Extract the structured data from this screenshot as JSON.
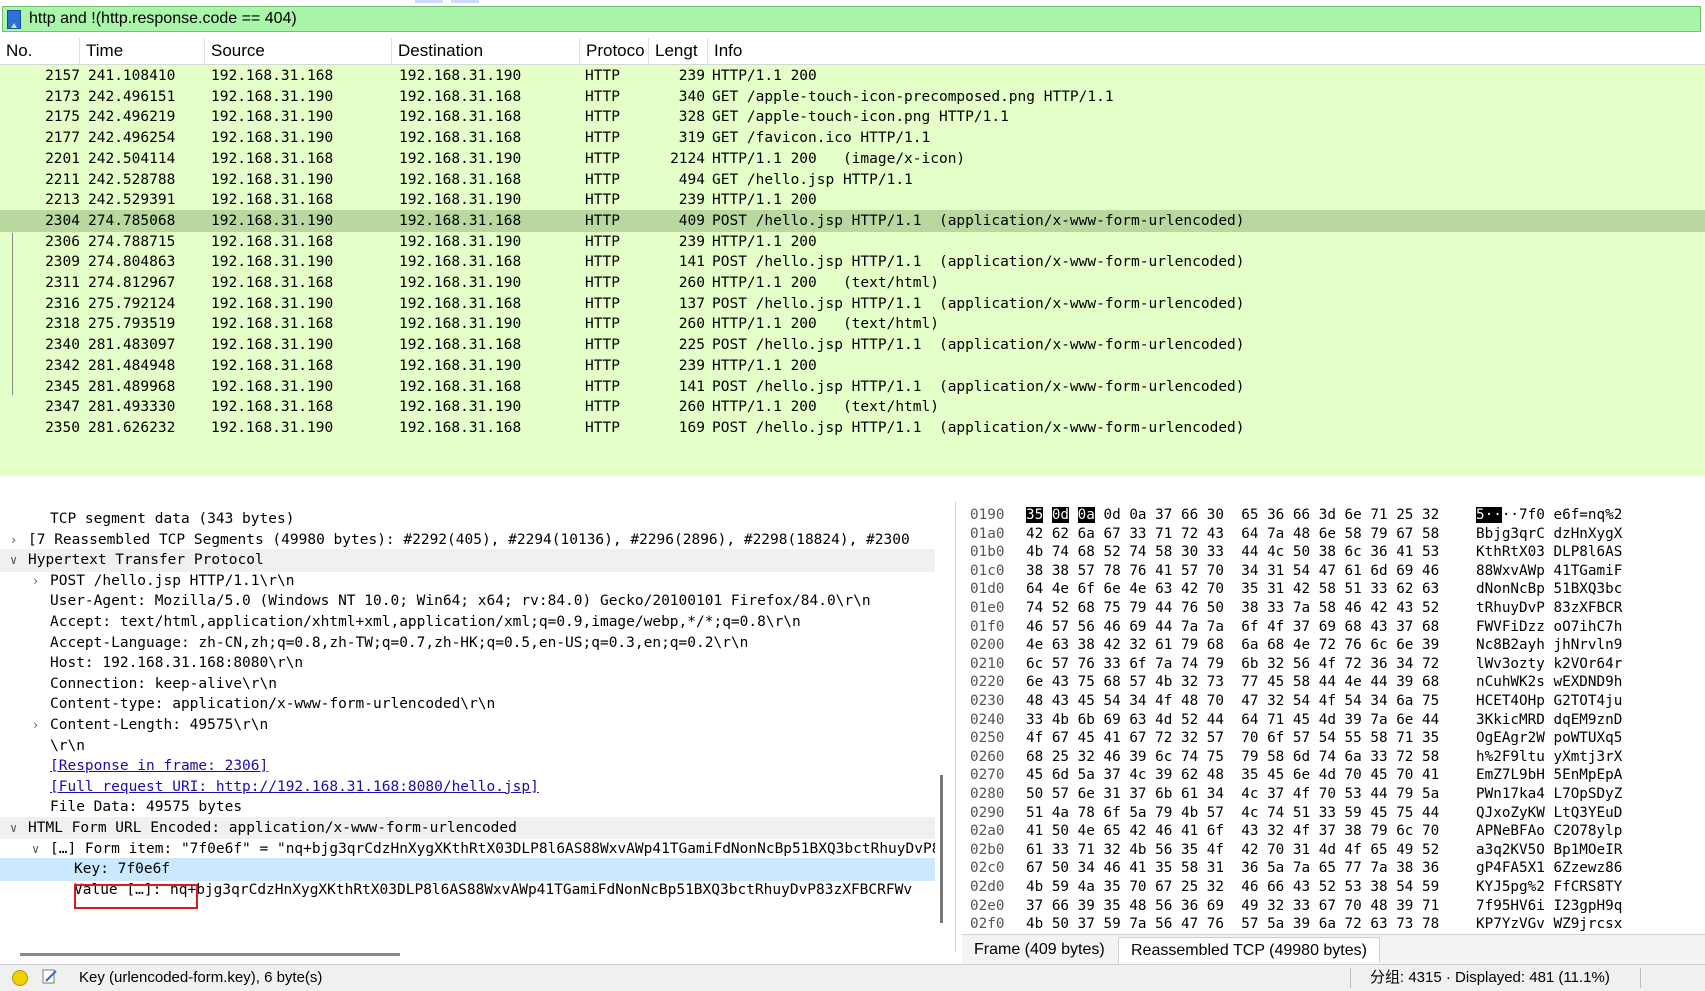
{
  "filter": {
    "value": "http and !(http.response.code == 404)",
    "icon": "bookmark-icon",
    "color": "#a9f5a9"
  },
  "packet_list": {
    "columns": [
      "No.",
      "Time",
      "Source",
      "Destination",
      "Protoco",
      "Lengt",
      "Info"
    ],
    "rows": [
      {
        "no": "2157",
        "time": "241.108410",
        "src": "192.168.31.168",
        "dst": "192.168.31.190",
        "proto": "HTTP",
        "len": "239",
        "info": "HTTP/1.1 200"
      },
      {
        "no": "2173",
        "time": "242.496151",
        "src": "192.168.31.190",
        "dst": "192.168.31.168",
        "proto": "HTTP",
        "len": "340",
        "info": "GET /apple-touch-icon-precomposed.png HTTP/1.1"
      },
      {
        "no": "2175",
        "time": "242.496219",
        "src": "192.168.31.190",
        "dst": "192.168.31.168",
        "proto": "HTTP",
        "len": "328",
        "info": "GET /apple-touch-icon.png HTTP/1.1"
      },
      {
        "no": "2177",
        "time": "242.496254",
        "src": "192.168.31.190",
        "dst": "192.168.31.168",
        "proto": "HTTP",
        "len": "319",
        "info": "GET /favicon.ico HTTP/1.1"
      },
      {
        "no": "2201",
        "time": "242.504114",
        "src": "192.168.31.168",
        "dst": "192.168.31.190",
        "proto": "HTTP",
        "len": "2124",
        "info": "HTTP/1.1 200   (image/x-icon)"
      },
      {
        "no": "2211",
        "time": "242.528788",
        "src": "192.168.31.190",
        "dst": "192.168.31.168",
        "proto": "HTTP",
        "len": "494",
        "info": "GET /hello.jsp HTTP/1.1"
      },
      {
        "no": "2213",
        "time": "242.529391",
        "src": "192.168.31.168",
        "dst": "192.168.31.190",
        "proto": "HTTP",
        "len": "239",
        "info": "HTTP/1.1 200"
      },
      {
        "no": "2304",
        "time": "274.785068",
        "src": "192.168.31.190",
        "dst": "192.168.31.168",
        "proto": "HTTP",
        "len": "409",
        "info": "POST /hello.jsp HTTP/1.1  (application/x-www-form-urlencoded)"
      },
      {
        "no": "2306",
        "time": "274.788715",
        "src": "192.168.31.168",
        "dst": "192.168.31.190",
        "proto": "HTTP",
        "len": "239",
        "info": "HTTP/1.1 200"
      },
      {
        "no": "2309",
        "time": "274.804863",
        "src": "192.168.31.190",
        "dst": "192.168.31.168",
        "proto": "HTTP",
        "len": "141",
        "info": "POST /hello.jsp HTTP/1.1  (application/x-www-form-urlencoded)"
      },
      {
        "no": "2311",
        "time": "274.812967",
        "src": "192.168.31.168",
        "dst": "192.168.31.190",
        "proto": "HTTP",
        "len": "260",
        "info": "HTTP/1.1 200   (text/html)"
      },
      {
        "no": "2316",
        "time": "275.792124",
        "src": "192.168.31.190",
        "dst": "192.168.31.168",
        "proto": "HTTP",
        "len": "137",
        "info": "POST /hello.jsp HTTP/1.1  (application/x-www-form-urlencoded)"
      },
      {
        "no": "2318",
        "time": "275.793519",
        "src": "192.168.31.168",
        "dst": "192.168.31.190",
        "proto": "HTTP",
        "len": "260",
        "info": "HTTP/1.1 200   (text/html)"
      },
      {
        "no": "2340",
        "time": "281.483097",
        "src": "192.168.31.190",
        "dst": "192.168.31.168",
        "proto": "HTTP",
        "len": "225",
        "info": "POST /hello.jsp HTTP/1.1  (application/x-www-form-urlencoded)"
      },
      {
        "no": "2342",
        "time": "281.484948",
        "src": "192.168.31.168",
        "dst": "192.168.31.190",
        "proto": "HTTP",
        "len": "239",
        "info": "HTTP/1.1 200"
      },
      {
        "no": "2345",
        "time": "281.489968",
        "src": "192.168.31.190",
        "dst": "192.168.31.168",
        "proto": "HTTP",
        "len": "141",
        "info": "POST /hello.jsp HTTP/1.1  (application/x-www-form-urlencoded)"
      },
      {
        "no": "2347",
        "time": "281.493330",
        "src": "192.168.31.168",
        "dst": "192.168.31.190",
        "proto": "HTTP",
        "len": "260",
        "info": "HTTP/1.1 200   (text/html)"
      },
      {
        "no": "2350",
        "time": "281.626232",
        "src": "192.168.31.190",
        "dst": "192.168.31.168",
        "proto": "HTTP",
        "len": "169",
        "info": "POST /hello.jsp HTTP/1.1  (application/x-www-form-urlencoded)"
      }
    ],
    "selected_no": "2304",
    "row_color": "#e4ffc7",
    "selected_color": "#b8d8a0"
  },
  "details": {
    "lines": [
      {
        "text": "TCP segment data (343 bytes)",
        "indent": 2,
        "arrow": ""
      },
      {
        "text": "[7 Reassembled TCP Segments (49980 bytes): #2292(405), #2294(10136), #2296(2896), #2298(18824), #2300",
        "indent": 1,
        "arrow": "right"
      },
      {
        "text": "Hypertext Transfer Protocol",
        "indent": 1,
        "arrow": "down",
        "hl": true
      },
      {
        "text": "POST /hello.jsp HTTP/1.1\\r\\n",
        "indent": 2,
        "arrow": "right"
      },
      {
        "text": "User-Agent: Mozilla/5.0 (Windows NT 10.0; Win64; x64; rv:84.0) Gecko/20100101 Firefox/84.0\\r\\n",
        "indent": 2,
        "arrow": ""
      },
      {
        "text": "Accept: text/html,application/xhtml+xml,application/xml;q=0.9,image/webp,*/*;q=0.8\\r\\n",
        "indent": 2,
        "arrow": ""
      },
      {
        "text": "Accept-Language: zh-CN,zh;q=0.8,zh-TW;q=0.7,zh-HK;q=0.5,en-US;q=0.3,en;q=0.2\\r\\n",
        "indent": 2,
        "arrow": ""
      },
      {
        "text": "Host: 192.168.31.168:8080\\r\\n",
        "indent": 2,
        "arrow": ""
      },
      {
        "text": "Connection: keep-alive\\r\\n",
        "indent": 2,
        "arrow": ""
      },
      {
        "text": "Content-type: application/x-www-form-urlencoded\\r\\n",
        "indent": 2,
        "arrow": ""
      },
      {
        "text": "Content-Length: 49575\\r\\n",
        "indent": 2,
        "arrow": "right"
      },
      {
        "text": "\\r\\n",
        "indent": 2,
        "arrow": ""
      },
      {
        "text": "[Response in frame: 2306]",
        "indent": 2,
        "arrow": "",
        "link": true
      },
      {
        "text": "[Full request URI: http://192.168.31.168:8080/hello.jsp]",
        "indent": 2,
        "arrow": "",
        "link": true
      },
      {
        "text": "File Data: 49575 bytes",
        "indent": 2,
        "arrow": ""
      },
      {
        "text": "HTML Form URL Encoded: application/x-www-form-urlencoded",
        "indent": 1,
        "arrow": "down",
        "hl": true
      },
      {
        "text": "[…] Form item: \"7f0e6f\" = \"nq+bjg3qrCdzHnXygXKthRtX03DLP8l6AS88WxvAWp41TGamiFdNonNcBp51BXQ3bctRhuyDvP83zXFBCRFWv",
        "indent": 2,
        "arrow": "down"
      },
      {
        "text": "Key: 7f0e6f",
        "indent": 3,
        "arrow": "",
        "sel": true
      },
      {
        "text": "Value […]: nq+bjg3qrCdzHnXygXKthRtX03DLP8l6AS88WxvAWp41TGamiFdNonNcBp51BXQ3bctRhuyDvP83zXFBCRFWv",
        "indent": 3,
        "arrow": ""
      }
    ]
  },
  "bytes": {
    "rows": [
      {
        "off": "0190",
        "hex1": [
          "35",
          "0d",
          "0a",
          "0d",
          "0a",
          "37",
          "66",
          "30"
        ],
        "hex2": [
          "65",
          "36",
          "66",
          "3d",
          "6e",
          "71",
          "25",
          "32"
        ],
        "asc1": "5····7f0",
        "asc2": "e6f=nq%2"
      },
      {
        "off": "01a0",
        "hex1": [
          "42",
          "62",
          "6a",
          "67",
          "33",
          "71",
          "72",
          "43"
        ],
        "hex2": [
          "64",
          "7a",
          "48",
          "6e",
          "58",
          "79",
          "67",
          "58"
        ],
        "asc1": "Bbjg3qrC",
        "asc2": "dzHnXygX"
      },
      {
        "off": "01b0",
        "hex1": [
          "4b",
          "74",
          "68",
          "52",
          "74",
          "58",
          "30",
          "33"
        ],
        "hex2": [
          "44",
          "4c",
          "50",
          "38",
          "6c",
          "36",
          "41",
          "53"
        ],
        "asc1": "KthRtX03",
        "asc2": "DLP8l6AS"
      },
      {
        "off": "01c0",
        "hex1": [
          "38",
          "38",
          "57",
          "78",
          "76",
          "41",
          "57",
          "70"
        ],
        "hex2": [
          "34",
          "31",
          "54",
          "47",
          "61",
          "6d",
          "69",
          "46"
        ],
        "asc1": "88WxvAWp",
        "asc2": "41TGamiF"
      },
      {
        "off": "01d0",
        "hex1": [
          "64",
          "4e",
          "6f",
          "6e",
          "4e",
          "63",
          "42",
          "70"
        ],
        "hex2": [
          "35",
          "31",
          "42",
          "58",
          "51",
          "33",
          "62",
          "63"
        ],
        "asc1": "dNonNcBp",
        "asc2": "51BXQ3bc"
      },
      {
        "off": "01e0",
        "hex1": [
          "74",
          "52",
          "68",
          "75",
          "79",
          "44",
          "76",
          "50"
        ],
        "hex2": [
          "38",
          "33",
          "7a",
          "58",
          "46",
          "42",
          "43",
          "52"
        ],
        "asc1": "tRhuyDvP",
        "asc2": "83zXFBCR"
      },
      {
        "off": "01f0",
        "hex1": [
          "46",
          "57",
          "56",
          "46",
          "69",
          "44",
          "7a",
          "7a"
        ],
        "hex2": [
          "6f",
          "4f",
          "37",
          "69",
          "68",
          "43",
          "37",
          "68"
        ],
        "asc1": "FWVFiDzz",
        "asc2": "oO7ihC7h"
      },
      {
        "off": "0200",
        "hex1": [
          "4e",
          "63",
          "38",
          "42",
          "32",
          "61",
          "79",
          "68"
        ],
        "hex2": [
          "6a",
          "68",
          "4e",
          "72",
          "76",
          "6c",
          "6e",
          "39"
        ],
        "asc1": "Nc8B2ayh",
        "asc2": "jhNrvln9"
      },
      {
        "off": "0210",
        "hex1": [
          "6c",
          "57",
          "76",
          "33",
          "6f",
          "7a",
          "74",
          "79"
        ],
        "hex2": [
          "6b",
          "32",
          "56",
          "4f",
          "72",
          "36",
          "34",
          "72"
        ],
        "asc1": "lWv3ozty",
        "asc2": "k2VOr64r"
      },
      {
        "off": "0220",
        "hex1": [
          "6e",
          "43",
          "75",
          "68",
          "57",
          "4b",
          "32",
          "73"
        ],
        "hex2": [
          "77",
          "45",
          "58",
          "44",
          "4e",
          "44",
          "39",
          "68"
        ],
        "asc1": "nCuhWK2s",
        "asc2": "wEXDND9h"
      },
      {
        "off": "0230",
        "hex1": [
          "48",
          "43",
          "45",
          "54",
          "34",
          "4f",
          "48",
          "70"
        ],
        "hex2": [
          "47",
          "32",
          "54",
          "4f",
          "54",
          "34",
          "6a",
          "75"
        ],
        "asc1": "HCET4OHp",
        "asc2": "G2TOT4ju"
      },
      {
        "off": "0240",
        "hex1": [
          "33",
          "4b",
          "6b",
          "69",
          "63",
          "4d",
          "52",
          "44"
        ],
        "hex2": [
          "64",
          "71",
          "45",
          "4d",
          "39",
          "7a",
          "6e",
          "44"
        ],
        "asc1": "3KkicMRD",
        "asc2": "dqEM9znD"
      },
      {
        "off": "0250",
        "hex1": [
          "4f",
          "67",
          "45",
          "41",
          "67",
          "72",
          "32",
          "57"
        ],
        "hex2": [
          "70",
          "6f",
          "57",
          "54",
          "55",
          "58",
          "71",
          "35"
        ],
        "asc1": "OgEAgr2W",
        "asc2": "poWTUXq5"
      },
      {
        "off": "0260",
        "hex1": [
          "68",
          "25",
          "32",
          "46",
          "39",
          "6c",
          "74",
          "75"
        ],
        "hex2": [
          "79",
          "58",
          "6d",
          "74",
          "6a",
          "33",
          "72",
          "58"
        ],
        "asc1": "h%2F9ltu",
        "asc2": "yXmtj3rX"
      },
      {
        "off": "0270",
        "hex1": [
          "45",
          "6d",
          "5a",
          "37",
          "4c",
          "39",
          "62",
          "48"
        ],
        "hex2": [
          "35",
          "45",
          "6e",
          "4d",
          "70",
          "45",
          "70",
          "41"
        ],
        "asc1": "EmZ7L9bH",
        "asc2": "5EnMpEpA"
      },
      {
        "off": "0280",
        "hex1": [
          "50",
          "57",
          "6e",
          "31",
          "37",
          "6b",
          "61",
          "34"
        ],
        "hex2": [
          "4c",
          "37",
          "4f",
          "70",
          "53",
          "44",
          "79",
          "5a"
        ],
        "asc1": "PWn17ka4",
        "asc2": "L7OpSDyZ"
      },
      {
        "off": "0290",
        "hex1": [
          "51",
          "4a",
          "78",
          "6f",
          "5a",
          "79",
          "4b",
          "57"
        ],
        "hex2": [
          "4c",
          "74",
          "51",
          "33",
          "59",
          "45",
          "75",
          "44"
        ],
        "asc1": "QJxoZyKW",
        "asc2": "LtQ3YEuD"
      },
      {
        "off": "02a0",
        "hex1": [
          "41",
          "50",
          "4e",
          "65",
          "42",
          "46",
          "41",
          "6f"
        ],
        "hex2": [
          "43",
          "32",
          "4f",
          "37",
          "38",
          "79",
          "6c",
          "70"
        ],
        "asc1": "APNeBFAo",
        "asc2": "C2O78ylp"
      },
      {
        "off": "02b0",
        "hex1": [
          "61",
          "33",
          "71",
          "32",
          "4b",
          "56",
          "35",
          "4f"
        ],
        "hex2": [
          "42",
          "70",
          "31",
          "4d",
          "4f",
          "65",
          "49",
          "52"
        ],
        "asc1": "a3q2KV5O",
        "asc2": "Bp1MOeIR"
      },
      {
        "off": "02c0",
        "hex1": [
          "67",
          "50",
          "34",
          "46",
          "41",
          "35",
          "58",
          "31"
        ],
        "hex2": [
          "36",
          "5a",
          "7a",
          "65",
          "77",
          "7a",
          "38",
          "36"
        ],
        "asc1": "gP4FA5X1",
        "asc2": "6Zzewz86"
      },
      {
        "off": "02d0",
        "hex1": [
          "4b",
          "59",
          "4a",
          "35",
          "70",
          "67",
          "25",
          "32"
        ],
        "hex2": [
          "46",
          "66",
          "43",
          "52",
          "53",
          "38",
          "54",
          "59"
        ],
        "asc1": "KYJ5pg%2",
        "asc2": "FfCRS8TY"
      },
      {
        "off": "02e0",
        "hex1": [
          "37",
          "66",
          "39",
          "35",
          "48",
          "56",
          "36",
          "69"
        ],
        "hex2": [
          "49",
          "32",
          "33",
          "67",
          "70",
          "48",
          "39",
          "71"
        ],
        "asc1": "7f95HV6i",
        "asc2": "I23gpH9q"
      },
      {
        "off": "02f0",
        "hex1": [
          "4b",
          "50",
          "37",
          "59",
          "7a",
          "56",
          "47",
          "76"
        ],
        "hex2": [
          "57",
          "5a",
          "39",
          "6a",
          "72",
          "63",
          "73",
          "78"
        ],
        "asc1": "KP7YzVGv",
        "asc2": "WZ9jrcsx"
      }
    ],
    "tabs": [
      "Frame (409 bytes)",
      "Reassembled TCP (49980 bytes)"
    ]
  },
  "status": {
    "field_info": "Key (urlencoded-form.key), 6 byte(s)",
    "counts": "分组: 4315 · Displayed: 481 (11.1%)",
    "led_color": "#f0d000"
  }
}
